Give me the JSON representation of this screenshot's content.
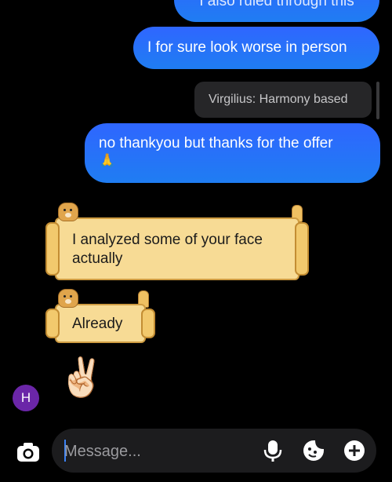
{
  "thread": {
    "top_partial_message": "I also ruled through this",
    "outgoing": [
      {
        "text": "I for sure look worse in person"
      },
      {
        "text": "no thankyou but thanks for the offer",
        "emoji": "🙏"
      }
    ],
    "reply_quote": "Virgilius: Harmony based",
    "incoming": [
      {
        "text": "I analyzed some of your face actually"
      },
      {
        "text": "Already"
      }
    ],
    "incoming_emoji": "✌🏻",
    "avatar_initial": "H"
  },
  "composer": {
    "placeholder": "Message...",
    "icons": [
      "camera-icon",
      "microphone-icon",
      "sticker-icon",
      "plus-icon"
    ]
  },
  "colors": {
    "background": "#000000",
    "outgoing_bubble": "#2f66ff",
    "reply_quote_bg": "#262628",
    "scroll_bubble": "#f7db95",
    "avatar": "#6b26a8",
    "composer_bg": "#1c1c1e"
  }
}
